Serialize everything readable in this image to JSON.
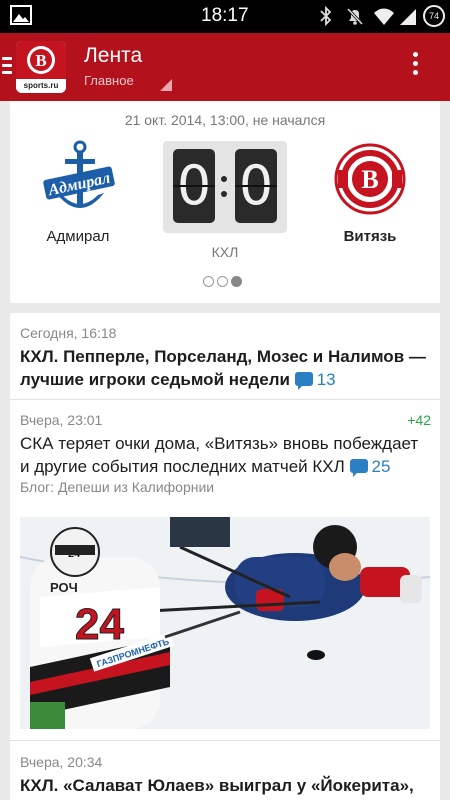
{
  "status_bar": {
    "time": "18:17",
    "battery": "74",
    "icons": [
      "gallery-icon",
      "bluetooth-icon",
      "mute-icon",
      "wifi-icon",
      "signal-icon",
      "battery-icon"
    ]
  },
  "app_bar": {
    "title": "Лента",
    "subtitle": "Главное",
    "logo_text": "sports.ru",
    "color": "#b3121d"
  },
  "match": {
    "datetime_status": "21 окт. 2014, 13:00, не начался",
    "home_team": "Адмирал",
    "away_team": "Витязь",
    "score_home": "0",
    "score_away": "0",
    "league": "КХЛ",
    "pager": {
      "total": 3,
      "active": 3
    }
  },
  "feed": [
    {
      "date": "Сегодня, 16:18",
      "headline": "КХЛ. Пепперле, Порселанд, Мозес и Налимов — лучшие игроки седьмой недели",
      "comments": "13"
    },
    {
      "date": "Вчера, 23:01",
      "rating": "+42",
      "headline": "СКА теряет очки дома, «Витязь» вновь побеждает и другие события последних матчей КХЛ",
      "comments": "25",
      "blog": "Блог: Депеши из Калифорнии",
      "image": "hockey-game-photo",
      "jersey_number": "24",
      "jersey_name": "РОЧ",
      "sponsor": "ГАЗПРОМНЕФТЬ"
    },
    {
      "date": "Вчера, 20:34",
      "headline": "КХЛ. «Салават Юлаев» выиграл у «Йокерита»,"
    }
  ],
  "colors": {
    "accent_red": "#b3121d",
    "comment_blue": "#2b7fc2",
    "rating_green": "#2aa34a"
  }
}
